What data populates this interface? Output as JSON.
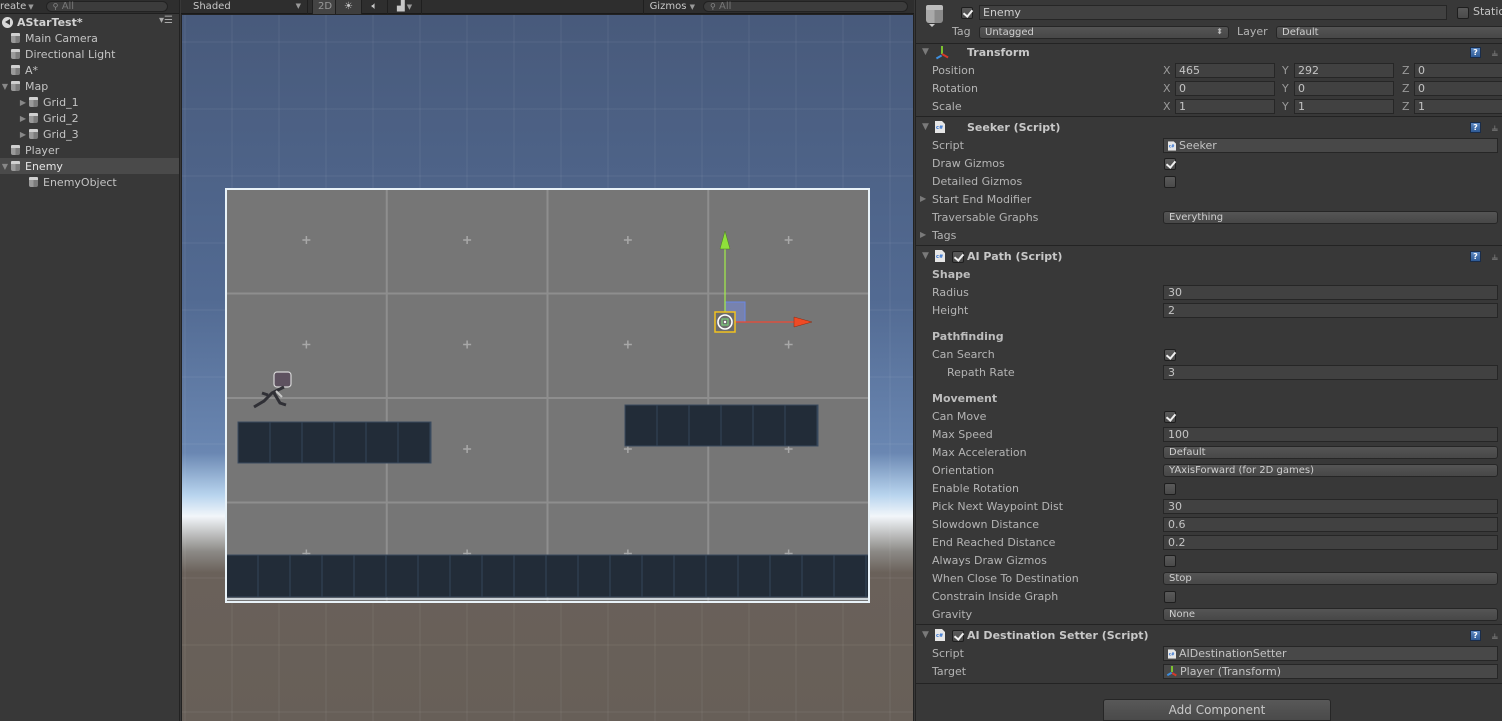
{
  "hierarchy": {
    "create_label": "reate",
    "search_placeholder": "All",
    "scene_name": "AStarTest*",
    "items": [
      {
        "label": "Main Camera",
        "depth": 0,
        "foldout": "none",
        "selected": false
      },
      {
        "label": "Directional Light",
        "depth": 0,
        "foldout": "none",
        "selected": false
      },
      {
        "label": "A*",
        "depth": 0,
        "foldout": "none",
        "selected": false
      },
      {
        "label": "Map",
        "depth": 0,
        "foldout": "expanded",
        "selected": false
      },
      {
        "label": "Grid_1",
        "depth": 1,
        "foldout": "collapsed",
        "selected": false
      },
      {
        "label": "Grid_2",
        "depth": 1,
        "foldout": "collapsed",
        "selected": false
      },
      {
        "label": "Grid_3",
        "depth": 1,
        "foldout": "collapsed",
        "selected": false
      },
      {
        "label": "Player",
        "depth": 0,
        "foldout": "none",
        "selected": false
      },
      {
        "label": "Enemy",
        "depth": 0,
        "foldout": "expanded",
        "selected": true
      },
      {
        "label": "EnemyObject",
        "depth": 1,
        "foldout": "none",
        "selected": false
      }
    ]
  },
  "scene": {
    "toolbar": {
      "draw_mode": "Shaded",
      "mode_2d": "2D",
      "lighting_icon": "sun-icon",
      "audio_icon": "speaker-icon",
      "effects_icon": "image-icon",
      "gizmos_label": "Gizmos",
      "search_placeholder": "All"
    }
  },
  "inspector": {
    "object_name": "Enemy",
    "active": true,
    "static_label": "Static",
    "static": false,
    "tag_label": "Tag",
    "tag_value": "Untagged",
    "layer_label": "Layer",
    "layer_value": "Default",
    "transform": {
      "title": "Transform",
      "position": {
        "label": "Position",
        "x": "465",
        "y": "292",
        "z": "0"
      },
      "rotation": {
        "label": "Rotation",
        "x": "0",
        "y": "0",
        "z": "0"
      },
      "scale": {
        "label": "Scale",
        "x": "1",
        "y": "1",
        "z": "1"
      }
    },
    "seeker": {
      "title": "Seeker (Script)",
      "script_label": "Script",
      "script_value": "Seeker",
      "draw_gizmos_label": "Draw Gizmos",
      "draw_gizmos": true,
      "detailed_gizmos_label": "Detailed Gizmos",
      "detailed_gizmos": false,
      "start_end_modifier_label": "Start End Modifier",
      "traversable_graphs_label": "Traversable Graphs",
      "traversable_graphs": "Everything",
      "tags_label": "Tags"
    },
    "ai_path": {
      "title": "AI Path (Script)",
      "enabled": true,
      "shape_header": "Shape",
      "radius_label": "Radius",
      "radius": "30",
      "height_label": "Height",
      "height": "2",
      "pathfinding_header": "Pathfinding",
      "can_search_label": "Can Search",
      "can_search": true,
      "repath_rate_label": "Repath Rate",
      "repath_rate": "3",
      "movement_header": "Movement",
      "can_move_label": "Can Move",
      "can_move": true,
      "max_speed_label": "Max Speed",
      "max_speed": "100",
      "max_acceleration_label": "Max Acceleration",
      "max_acceleration": "Default",
      "orientation_label": "Orientation",
      "orientation": "YAxisForward (for 2D games)",
      "enable_rotation_label": "Enable Rotation",
      "enable_rotation": false,
      "pick_next_waypoint_dist_label": "Pick Next Waypoint Dist",
      "pick_next_waypoint_dist": "30",
      "slowdown_distance_label": "Slowdown Distance",
      "slowdown_distance": "0.6",
      "end_reached_distance_label": "End Reached Distance",
      "end_reached_distance": "0.2",
      "always_draw_gizmos_label": "Always Draw Gizmos",
      "always_draw_gizmos": false,
      "when_close_label": "When Close To Destination",
      "when_close": "Stop",
      "constrain_label": "Constrain Inside Graph",
      "constrain": false,
      "gravity_label": "Gravity",
      "gravity": "None"
    },
    "destination_setter": {
      "title": "AI Destination Setter (Script)",
      "enabled": true,
      "script_label": "Script",
      "script_value": "AIDestinationSetter",
      "target_label": "Target",
      "target_value": "Player (Transform)"
    },
    "add_component_label": "Add Component",
    "help_glyph": "?",
    "settings_glyph": "⚙"
  }
}
